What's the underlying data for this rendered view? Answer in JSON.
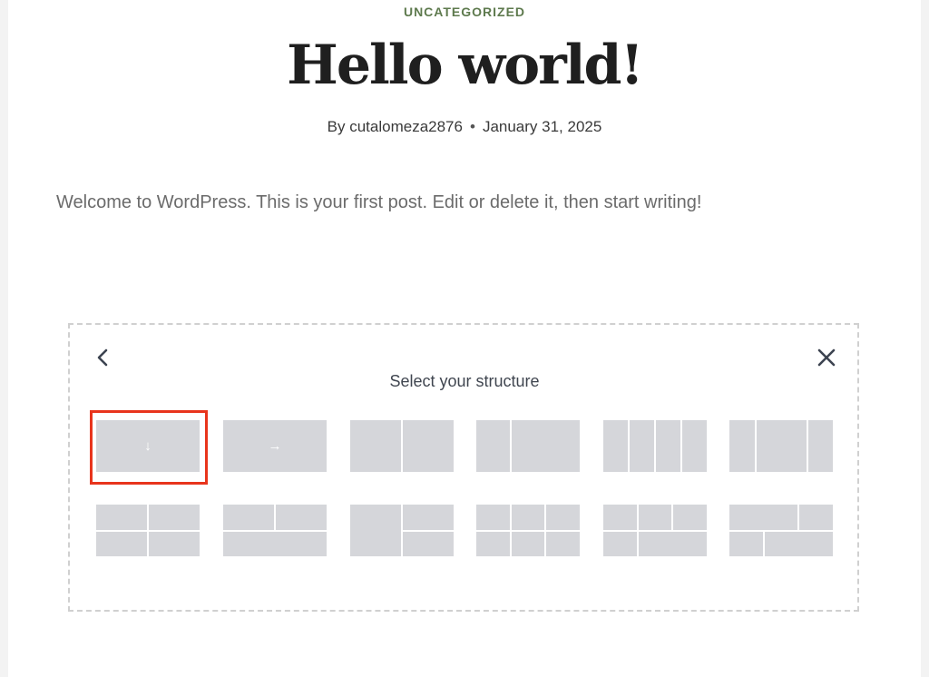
{
  "post": {
    "category": "UNCATEGORIZED",
    "title": "Hello world!",
    "author": "By cutalomeza2876",
    "separator": "•",
    "date": "January 31, 2025",
    "excerpt": "Welcome to WordPress. This is your first post. Edit or delete it, then start writing!"
  },
  "structure_picker": {
    "label": "Select your structure",
    "back_icon": "chevron-left-icon",
    "close_icon": "close-icon",
    "presets": [
      {
        "name": "row-layout",
        "icon": "arrow-down-icon",
        "glyph": "↓",
        "selected": true
      },
      {
        "name": "column-layout",
        "icon": "arrow-right-icon",
        "glyph": "→",
        "selected": false
      }
    ]
  },
  "colors": {
    "accent_category": "#5e7a4e",
    "highlight": "#e8341c",
    "cell": "#d5d6da"
  }
}
